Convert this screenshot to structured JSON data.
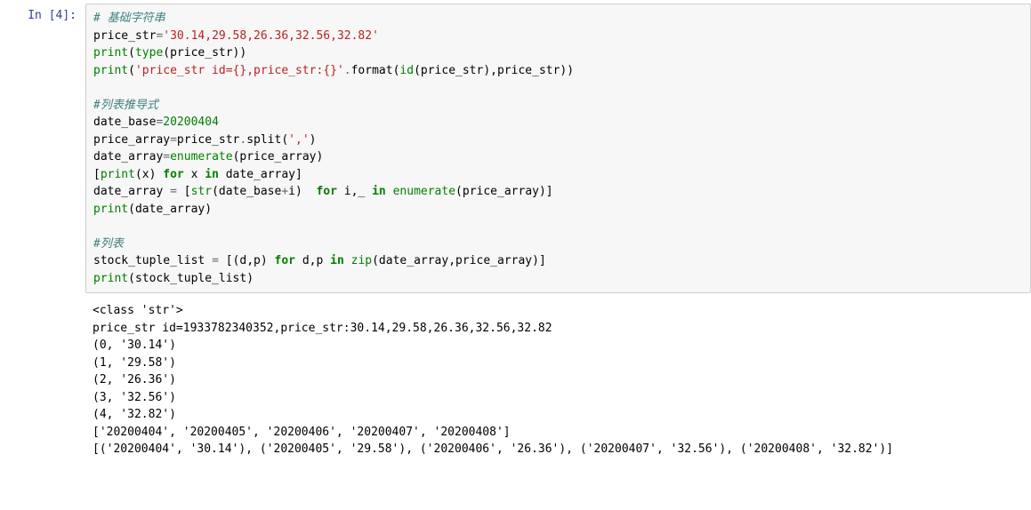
{
  "prompt": {
    "label": "In",
    "num": "[4]:"
  },
  "code": {
    "l1_cmt": "# 基础字符串",
    "l2_a": "price_str",
    "l2_b": "=",
    "l2_c": "'30.14,29.58,26.36,32.56,32.82'",
    "l3_a": "print",
    "l3_b": "(",
    "l3_c": "type",
    "l3_d": "(price_str))",
    "l4_a": "print",
    "l4_b": "(",
    "l4_c": "'price_str id={},price_str:{}'",
    "l4_d": ".",
    "l4_e": "format",
    "l4_f": "(",
    "l4_g": "id",
    "l4_h": "(price_str),price_str))",
    "l5_cmt": "#列表推导式",
    "l6_a": "date_base",
    "l6_b": "=",
    "l6_c": "20200404",
    "l7_a": "price_array",
    "l7_b": "=",
    "l7_c": "price_str",
    "l7_d": ".",
    "l7_e": "split",
    "l7_f": "(",
    "l7_g": "','",
    "l7_h": ")",
    "l8_a": "date_array",
    "l8_b": "=",
    "l8_c": "enumerate",
    "l8_d": "(price_array)",
    "l9_a": "[",
    "l9_b": "print",
    "l9_c": "(x) ",
    "l9_d": "for",
    "l9_e": " x ",
    "l9_f": "in",
    "l9_g": " date_array]",
    "l10_a": "date_array ",
    "l10_b": "=",
    "l10_c": " [",
    "l10_d": "str",
    "l10_e": "(date_base",
    "l10_f": "+",
    "l10_g": "i)  ",
    "l10_h": "for",
    "l10_i": " i,_ ",
    "l10_j": "in",
    "l10_k": " ",
    "l10_l": "enumerate",
    "l10_m": "(price_array)]",
    "l11_a": "print",
    "l11_b": "(date_array)",
    "l12_cmt": "#列表",
    "l13_a": "stock_tuple_list ",
    "l13_b": "=",
    "l13_c": " [(d,p) ",
    "l13_d": "for",
    "l13_e": " d,p ",
    "l13_f": "in",
    "l13_g": " ",
    "l13_h": "zip",
    "l13_i": "(date_array,price_array)]",
    "l14_a": "print",
    "l14_b": "(stock_tuple_list)"
  },
  "output": {
    "l1": "<class 'str'>",
    "l2": "price_str id=1933782340352,price_str:30.14,29.58,26.36,32.56,32.82",
    "l3": "(0, '30.14')",
    "l4": "(1, '29.58')",
    "l5": "(2, '26.36')",
    "l6": "(3, '32.56')",
    "l7": "(4, '32.82')",
    "l8": "['20200404', '20200405', '20200406', '20200407', '20200408']",
    "l9": "[('20200404', '30.14'), ('20200405', '29.58'), ('20200406', '26.36'), ('20200407', '32.56'), ('20200408', '32.82')]"
  }
}
